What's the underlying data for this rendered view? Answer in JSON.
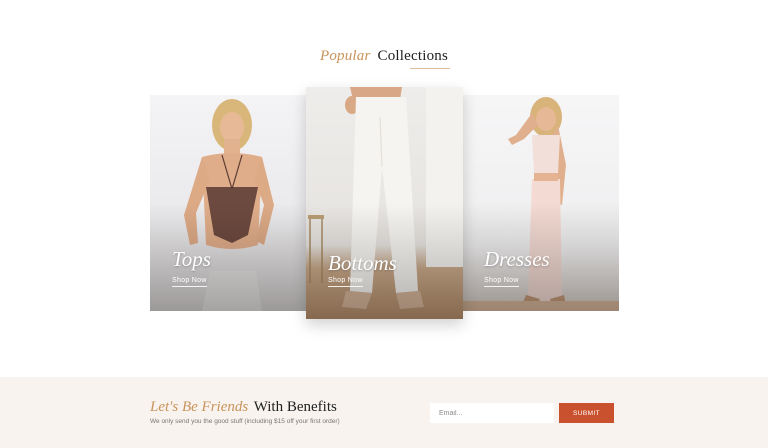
{
  "collections": {
    "heading_accent": "Popular",
    "heading_main": "Collections",
    "cards": [
      {
        "title": "Tops",
        "link": "Shop Now"
      },
      {
        "title": "Bottoms",
        "link": "Shop Now"
      },
      {
        "title": "Dresses",
        "link": "Shop Now"
      }
    ]
  },
  "newsletter": {
    "heading_accent": "Let's Be Friends",
    "heading_main": "With Benefits",
    "subtext": "We only send you the good stuff (including $15 off your first order)",
    "email_placeholder": "Email...",
    "submit_label": "SUBMIT"
  },
  "colors": {
    "accent": "#c9935a",
    "submit": "#c9512d",
    "band": "#f8f3ee"
  }
}
